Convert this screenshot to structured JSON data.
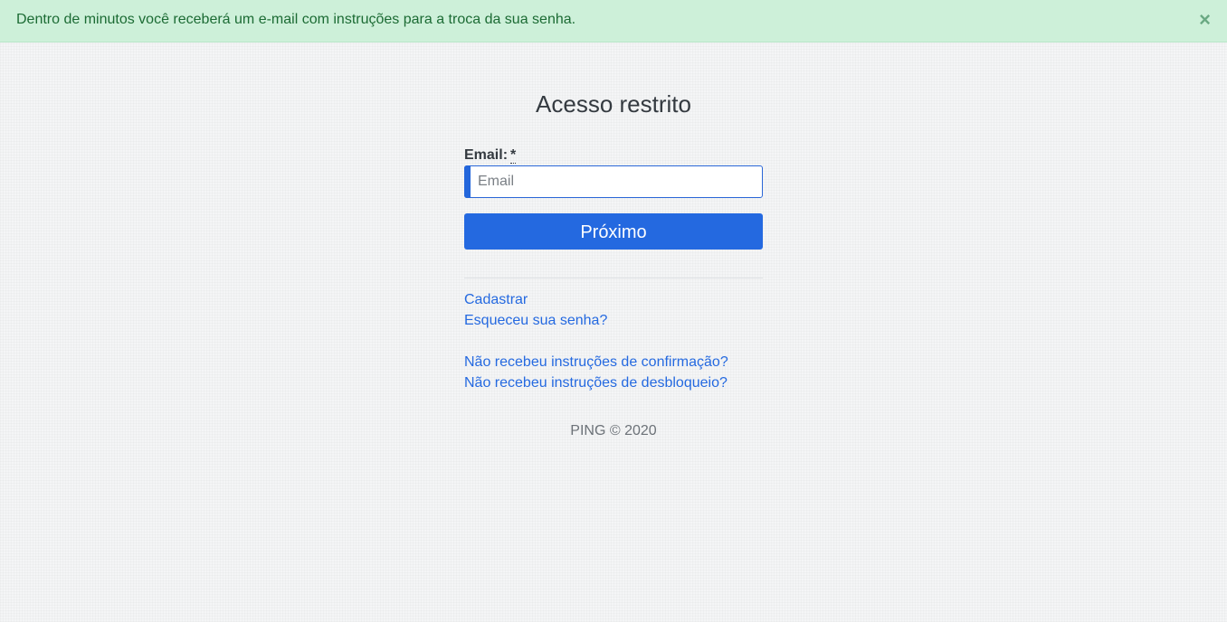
{
  "alert": {
    "message": "Dentro de minutos você receberá um e-mail com instruções para a troca da sua senha.",
    "close_symbol": "×"
  },
  "login": {
    "title": "Acesso restrito",
    "email_label": "Email:",
    "required_marker": "*",
    "email_placeholder": "Email",
    "email_value": "",
    "submit_label": "Próximo"
  },
  "links": {
    "register": "Cadastrar",
    "forgot_password": "Esqueceu sua senha?",
    "no_confirmation": "Não recebeu instruções de confirmação?",
    "no_unlock": "Não recebeu instruções de desbloqueio?"
  },
  "footer": {
    "text": "PING © 2020"
  },
  "colors": {
    "alert_bg": "#cdf0d9",
    "alert_text": "#1c6b34",
    "primary": "#2469e0",
    "link": "#2469e0"
  }
}
